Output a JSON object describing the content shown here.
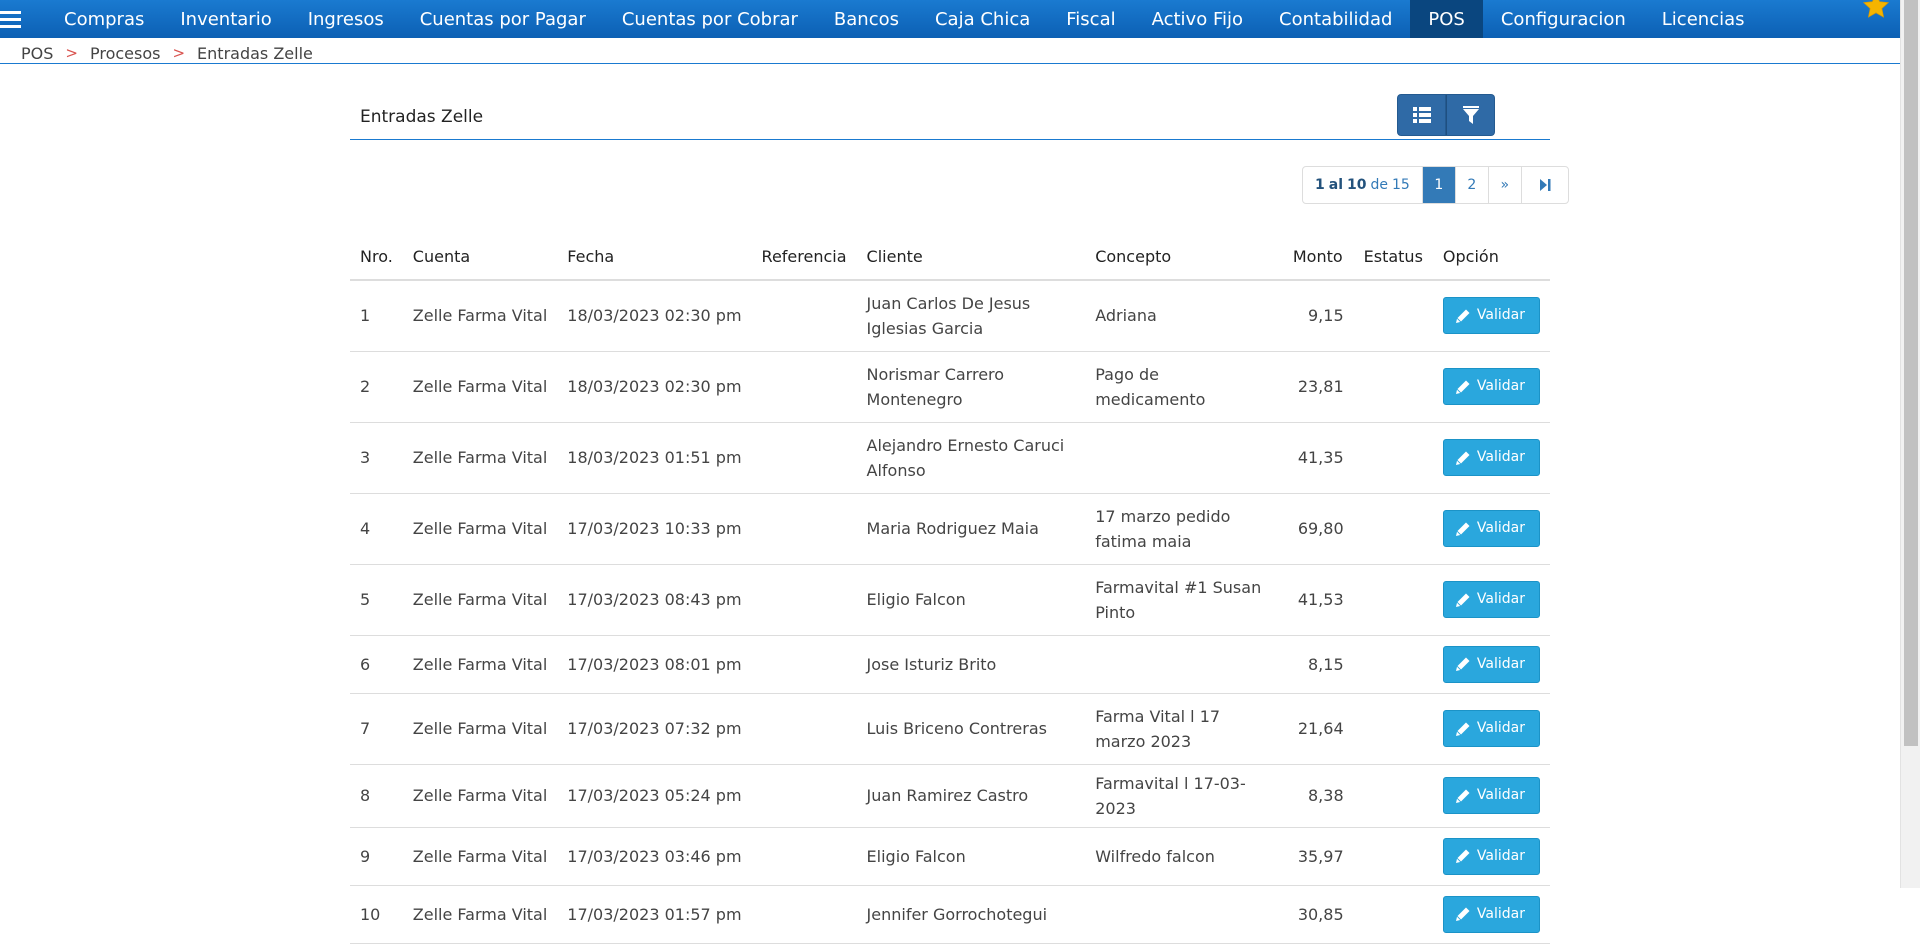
{
  "navbar": {
    "items": [
      {
        "label": "Compras",
        "icon": ""
      },
      {
        "label": "Inventario"
      },
      {
        "label": "Ingresos"
      },
      {
        "label": "Cuentas por Pagar"
      },
      {
        "label": "Cuentas por Cobrar"
      },
      {
        "label": "Bancos"
      },
      {
        "label": "Caja Chica"
      },
      {
        "label": "Fiscal"
      },
      {
        "label": "Activo Fijo"
      },
      {
        "label": "Contabilidad"
      },
      {
        "label": "POS"
      },
      {
        "label": "Configuracion"
      },
      {
        "label": "Licencias"
      }
    ],
    "active_item": "POS",
    "color": "#1a7ad0",
    "active_color": "#0a467f",
    "favorite_icon": "star-icon",
    "favorite_color": "#f5b400"
  },
  "breadcrumb": {
    "items": [
      "POS",
      "Procesos",
      "Entradas Zelle"
    ],
    "separator": ">"
  },
  "panel": {
    "title": "Entradas Zelle",
    "toolbar": {
      "list_icon": "list-icon",
      "filter_icon": "filter-icon"
    }
  },
  "pagination": {
    "range_start": "1",
    "range_sep": "al",
    "range_end": "10",
    "total_sep": "de",
    "total": "15",
    "pages": [
      "1",
      "2"
    ],
    "current_page": "1",
    "next_label": "»",
    "last_icon": "skip-to-end-icon"
  },
  "table": {
    "columns": [
      "Nro.",
      "Cuenta",
      "Fecha",
      "Referencia",
      "Cliente",
      "Concepto",
      "Monto",
      "Estatus",
      "Opción"
    ],
    "action_label": "Validar",
    "action_icon": "pencil-icon",
    "action_color": "#2aa7dd",
    "rows": [
      {
        "nro": "1",
        "cuenta": "Zelle Farma Vital",
        "fecha": "18/03/2023 02:30 pm",
        "referencia": "",
        "cliente": "Juan Carlos De Jesus Iglesias Garcia",
        "concepto": "Adriana",
        "monto": "9,15",
        "estatus": ""
      },
      {
        "nro": "2",
        "cuenta": "Zelle Farma Vital",
        "fecha": "18/03/2023 02:30 pm",
        "referencia": "",
        "cliente": "Norismar Carrero Montenegro",
        "concepto": "Pago de medicamento",
        "monto": "23,81",
        "estatus": ""
      },
      {
        "nro": "3",
        "cuenta": "Zelle Farma Vital",
        "fecha": "18/03/2023 01:51 pm",
        "referencia": "",
        "cliente": "Alejandro Ernesto Caruci Alfonso",
        "concepto": "",
        "monto": "41,35",
        "estatus": ""
      },
      {
        "nro": "4",
        "cuenta": "Zelle Farma Vital",
        "fecha": "17/03/2023 10:33 pm",
        "referencia": "",
        "cliente": "Maria Rodriguez Maia",
        "concepto": "17 marzo pedido fatima maia",
        "monto": "69,80",
        "estatus": ""
      },
      {
        "nro": "5",
        "cuenta": "Zelle Farma Vital",
        "fecha": "17/03/2023 08:43 pm",
        "referencia": "",
        "cliente": "Eligio Falcon",
        "concepto": "Farmavital #1 Susan Pinto",
        "monto": "41,53",
        "estatus": ""
      },
      {
        "nro": "6",
        "cuenta": "Zelle Farma Vital",
        "fecha": "17/03/2023 08:01 pm",
        "referencia": "",
        "cliente": "Jose Isturiz Brito",
        "concepto": "",
        "monto": "8,15",
        "estatus": ""
      },
      {
        "nro": "7",
        "cuenta": "Zelle Farma Vital",
        "fecha": "17/03/2023 07:32 pm",
        "referencia": "",
        "cliente": "Luis Briceno Contreras",
        "concepto": "Farma Vital l 17 marzo 2023",
        "monto": "21,64",
        "estatus": ""
      },
      {
        "nro": "8",
        "cuenta": "Zelle Farma Vital",
        "fecha": "17/03/2023 05:24 pm",
        "referencia": "",
        "cliente": "Juan Ramirez Castro",
        "concepto": "Farmavital l 17-03-2023",
        "monto": "8,38",
        "estatus": ""
      },
      {
        "nro": "9",
        "cuenta": "Zelle Farma Vital",
        "fecha": "17/03/2023 03:46 pm",
        "referencia": "",
        "cliente": "Eligio Falcon",
        "concepto": "Wilfredo falcon",
        "monto": "35,97",
        "estatus": ""
      },
      {
        "nro": "10",
        "cuenta": "Zelle Farma Vital",
        "fecha": "17/03/2023 01:57 pm",
        "referencia": "",
        "cliente": "Jennifer Gorrochotegui",
        "concepto": "",
        "monto": "30,85",
        "estatus": ""
      }
    ]
  }
}
